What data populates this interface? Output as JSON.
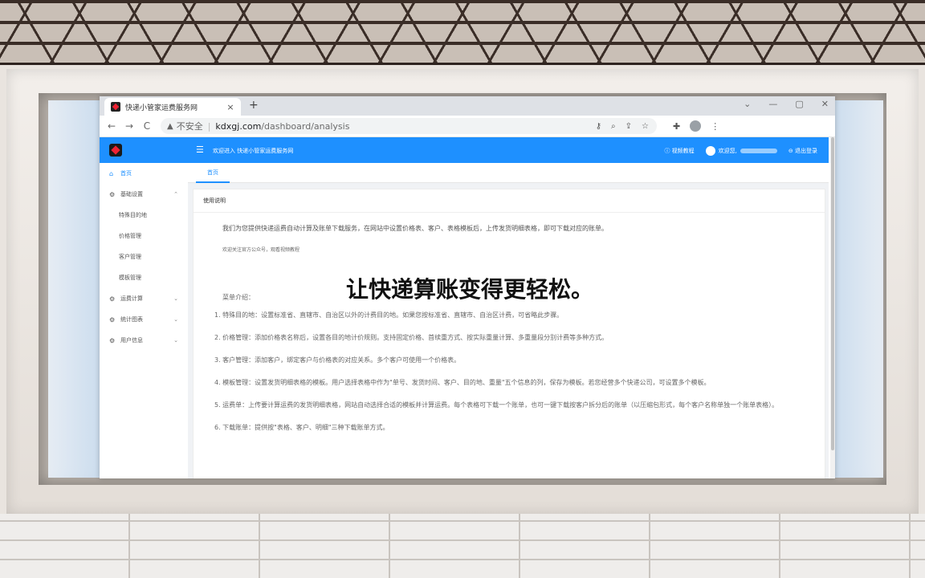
{
  "browser": {
    "tab_title": "快递小管家运费服务网",
    "tab_close": "×",
    "new_tab": "+",
    "window_controls": [
      "⌄",
      "—",
      "▢",
      "✕"
    ],
    "nav": {
      "back": "←",
      "forward": "→",
      "reload": "C"
    },
    "url_warning": "▲",
    "url_insecure": "不安全",
    "url_separator": "|",
    "url_host": "kdxgj.com",
    "url_path": "/dashboard/analysis",
    "omni_icons": [
      "key-icon",
      "zoom-icon",
      "share-icon",
      "star-icon"
    ],
    "ext_icons": [
      "puzzle-icon",
      "profile-icon",
      "menu-icon"
    ]
  },
  "app": {
    "header": {
      "menu_icon": "☰",
      "welcome": "欢迎进入 快递小管家运费服务网",
      "video_tutorial": "ⓘ 视频教程",
      "greeting": "欢迎您,",
      "logout": "⊖ 退出登录"
    },
    "sidebar": {
      "home": "首页",
      "basic_settings": "基础设置",
      "sub_items": [
        "特殊目的地",
        "价格管理",
        "客户管理",
        "模板管理"
      ],
      "freight_calc": "运费计算",
      "stats": "统计图表",
      "user_info": "用户信息"
    },
    "tabs": {
      "home": "首页"
    },
    "card": {
      "title": "使用说明",
      "intro": "我们为您提供快递运费自动计算及账单下载服务，在网站中设置价格表、客户、表格模板后，上传发货明细表格，即可下载对应的账单。",
      "follow": "欢迎关注官方公众号，观看视频教程",
      "slogan": "让快递算账变得更轻松。",
      "menu_intro": "菜单介绍：",
      "items": [
        "1. 特殊目的地：设置标准省、直辖市、自治区以外的计费目的地。如果您按标准省、直辖市、自治区计费，可省略此步骤。",
        "2. 价格管理：添加价格表名称后，设置各目的地计价规则。支持固定价格、首续重方式、按实际重量计算、多重量段分别计费等多种方式。",
        "3. 客户管理：添加客户，绑定客户与价格表的对应关系。多个客户可使用一个价格表。",
        "4. 模板管理：设置发货明细表格的模板。用户选择表格中作为\"单号、发货时间、客户、目的地、重量\"五个信息的列，保存为模板。若您经营多个快递公司，可设置多个模板。",
        "5. 运费单：上传要计算运费的发货明细表格，网站自动选择合适的模板并计算运费。每个表格可下载一个账单，也可一键下载按客户拆分后的账单（以压缩包形式，每个客户名称单独一个账单表格）。",
        "6. 下载账单：提供按\"表格、客户、明细\"三种下载账单方式。"
      ]
    }
  }
}
